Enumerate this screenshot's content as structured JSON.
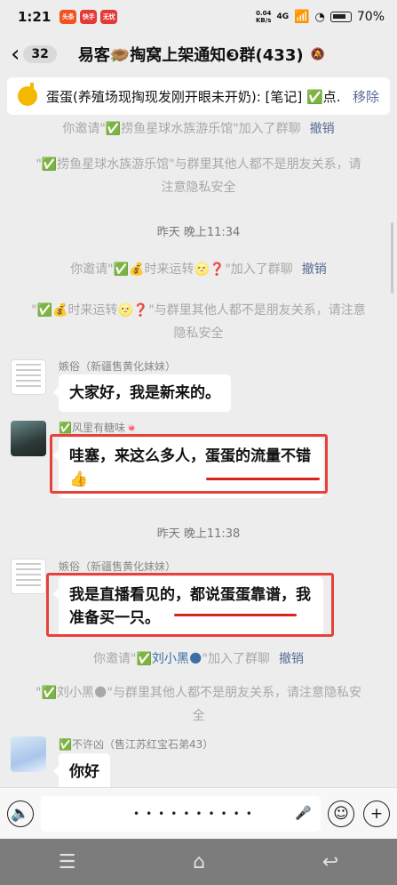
{
  "status": {
    "time": "1:21",
    "app_badges": [
      {
        "label": "头条",
        "color": "#f4511e"
      },
      {
        "label": "快手",
        "color": "#e53935"
      },
      {
        "label": "无忧",
        "color": "#e53935"
      }
    ],
    "net_speed_value": "0.04",
    "net_speed_unit": "KB/s",
    "network": "4G",
    "battery": "70%"
  },
  "header": {
    "unread_count": "32",
    "title": "易客🪹掏窝上架通知❸群(433)"
  },
  "pinned": {
    "text": "蛋蛋(养殖场现掏现发刚开眼未开奶): [笔记] ✅点…",
    "remove_label": "移除"
  },
  "messages": {
    "sys1": {
      "text": "你邀请\"✅捞鱼星球水族游乐馆\"加入了群聊",
      "action": "撤销"
    },
    "sys2": {
      "text": "\"✅捞鱼星球水族游乐馆\"与群里其他人都不是朋友关系，请注意隐私安全"
    },
    "time1": "昨天 晚上11:34",
    "sys3": {
      "text": "你邀请\"✅💰时来运转🌝❓\"加入了群聊",
      "action": "撤销"
    },
    "sys4": {
      "text": "\"✅💰时来运转🌝❓\"与群里其他人都不是朋友关系，请注意隐私安全"
    },
    "msg1": {
      "sender": "嫉俗（新疆售黄化妹妹）",
      "text": "大家好，我是新来的。"
    },
    "msg2": {
      "sender": "✅风里有糖味🍬",
      "text": "哇塞，来这么多人，蛋蛋的流量不错👍"
    },
    "time2": "昨天 晚上11:38",
    "msg3": {
      "sender": "嫉俗（新疆售黄化妹妹）",
      "text": "我是直播看见的，都说蛋蛋靠谱，我准备买一只。"
    },
    "sys5": {
      "text_before": "你邀请\"",
      "name": "✅刘小黑🌑",
      "text_after": "\"加入了群聊",
      "action": "撤销"
    },
    "sys6": {
      "text": "\"✅刘小黑🌑\"与群里其他人都不是朋友关系，请注意隐私安全"
    },
    "msg4": {
      "sender": "✅不许凶（售江苏红宝石弟43）",
      "text": "你好"
    }
  },
  "input": {
    "voice_icon": "🔈",
    "emoji_icon": "☺",
    "plus_icon": "+",
    "mic_icon": "🎤",
    "page_dots": "••••••••••"
  },
  "nav": {
    "menu": "☰",
    "home": "⌂",
    "back": "↩"
  }
}
